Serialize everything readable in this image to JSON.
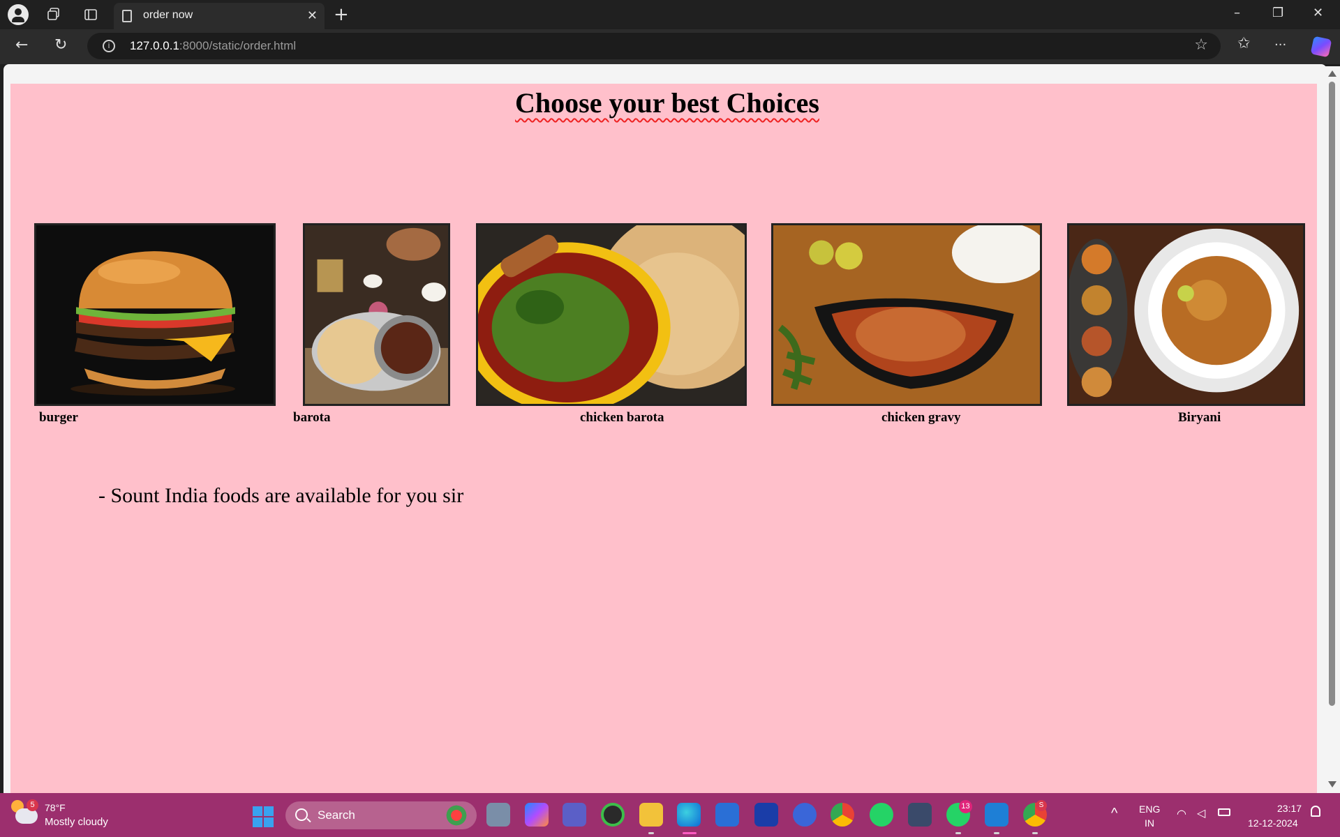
{
  "browser": {
    "tab_title": "order now",
    "url_host": "127.0.0.1",
    "url_rest": ":8000/static/order.html",
    "close_glyph": "✕",
    "new_tab_glyph": "+",
    "minimize_glyph": "–",
    "restore_glyph": "❐",
    "close_window_glyph": "✕",
    "back_glyph": "←",
    "reload_glyph": "↻",
    "info_glyph": "i",
    "star_glyph": "☆",
    "favorites_glyph": "✩",
    "more_glyph": "···"
  },
  "page": {
    "background": "#ffc0cb",
    "heading": "Choose your best Choices",
    "foods": [
      {
        "label": "burger",
        "icon": "burger-photo"
      },
      {
        "label": "barota",
        "icon": "barota-photo"
      },
      {
        "label": "chicken barota",
        "icon": "chicken-barota-photo"
      },
      {
        "label": "chicken gravy",
        "icon": "chicken-gravy-photo"
      },
      {
        "label": "Biryani",
        "icon": "biryani-photo"
      }
    ],
    "tagline": "- Sount India foods are available for you sir"
  },
  "taskbar": {
    "background": "#9c2f6e",
    "weather_badge": "5",
    "weather_temp": "78°F",
    "weather_condition": "Mostly cloudy",
    "search_label": "Search",
    "app_badges": {
      "whatsapp": "13",
      "chrome_profile": "S"
    },
    "lang_top": "ENG",
    "lang_bottom": "IN",
    "time": "23:17",
    "date": "12-12-2024"
  }
}
